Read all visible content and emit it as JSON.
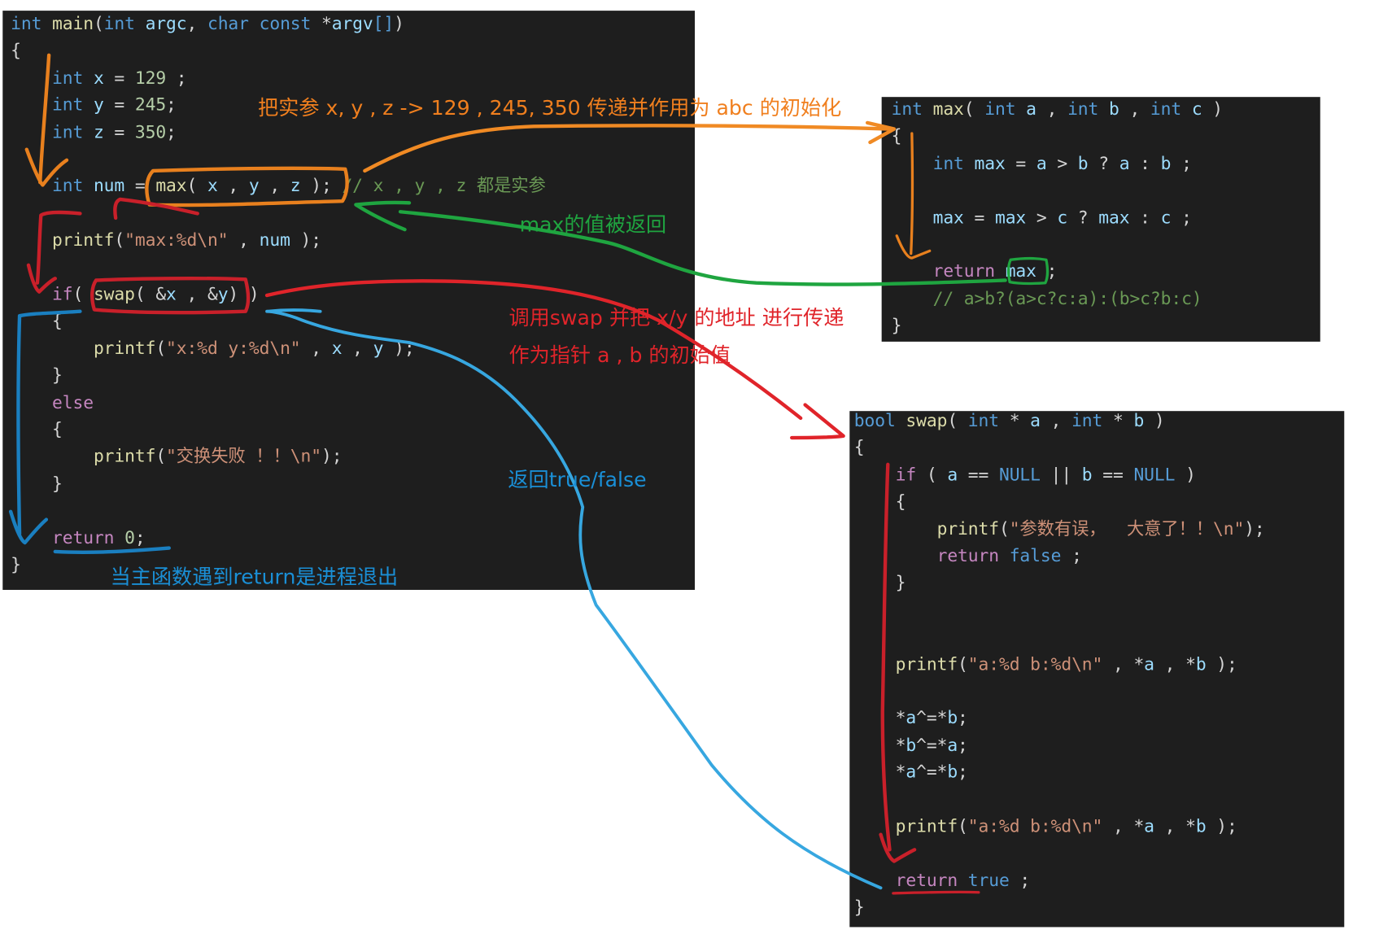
{
  "colors": {
    "orange": "#f07f1e",
    "green": "#1fa540",
    "red": "#e0242a",
    "blue": "#1a8fd6",
    "background": "#1e1e1e"
  },
  "main_code": [
    [
      [
        "int",
        "kw"
      ],
      [
        " ",
        "txt"
      ],
      [
        "main",
        "fn"
      ],
      [
        "(",
        "txt"
      ],
      [
        "int",
        "kw"
      ],
      [
        " ",
        "txt"
      ],
      [
        "argc",
        "var"
      ],
      [
        ", ",
        "txt"
      ],
      [
        "char",
        "kw"
      ],
      [
        " ",
        "txt"
      ],
      [
        "const",
        "kw"
      ],
      [
        " *",
        "txt"
      ],
      [
        "argv",
        "var"
      ],
      [
        "[]",
        "kw"
      ],
      [
        ")",
        "txt"
      ]
    ],
    [
      [
        "{",
        "txt"
      ]
    ],
    [
      [
        "    ",
        "txt"
      ],
      [
        "int",
        "kw"
      ],
      [
        " ",
        "txt"
      ],
      [
        "x",
        "var"
      ],
      [
        " = ",
        "txt"
      ],
      [
        "129",
        "num"
      ],
      [
        " ;",
        "txt"
      ]
    ],
    [
      [
        "    ",
        "txt"
      ],
      [
        "int",
        "kw"
      ],
      [
        " ",
        "txt"
      ],
      [
        "y",
        "var"
      ],
      [
        " = ",
        "txt"
      ],
      [
        "245",
        "num"
      ],
      [
        ";",
        "txt"
      ]
    ],
    [
      [
        "    ",
        "txt"
      ],
      [
        "int",
        "kw"
      ],
      [
        " ",
        "txt"
      ],
      [
        "z",
        "var"
      ],
      [
        " = ",
        "txt"
      ],
      [
        "350",
        "num"
      ],
      [
        ";",
        "txt"
      ]
    ],
    [],
    [
      [
        "    ",
        "txt"
      ],
      [
        "int",
        "kw"
      ],
      [
        " ",
        "txt"
      ],
      [
        "num",
        "var"
      ],
      [
        " = ",
        "txt"
      ],
      [
        "max",
        "fn"
      ],
      [
        "( ",
        "txt"
      ],
      [
        "x",
        "var"
      ],
      [
        " , ",
        "txt"
      ],
      [
        "y",
        "var"
      ],
      [
        " , ",
        "txt"
      ],
      [
        "z",
        "var"
      ],
      [
        " ); ",
        "txt"
      ],
      [
        "// x , y , z 都是实参",
        "cm"
      ]
    ],
    [],
    [
      [
        "    ",
        "txt"
      ],
      [
        "printf",
        "fn"
      ],
      [
        "(",
        "txt"
      ],
      [
        "\"max:%d\\n\"",
        "str"
      ],
      [
        " , ",
        "txt"
      ],
      [
        "num",
        "var"
      ],
      [
        " );",
        "txt"
      ]
    ],
    [],
    [
      [
        "    ",
        "txt"
      ],
      [
        "if",
        "ctl"
      ],
      [
        "( ",
        "txt"
      ],
      [
        "swap",
        "fn"
      ],
      [
        "( &",
        "txt"
      ],
      [
        "x",
        "var"
      ],
      [
        " , &",
        "txt"
      ],
      [
        "y",
        "var"
      ],
      [
        ") )",
        "txt"
      ]
    ],
    [
      [
        "    {",
        "txt"
      ]
    ],
    [
      [
        "        ",
        "txt"
      ],
      [
        "printf",
        "fn"
      ],
      [
        "(",
        "txt"
      ],
      [
        "\"x:%d y:%d\\n\"",
        "str"
      ],
      [
        " , ",
        "txt"
      ],
      [
        "x",
        "var"
      ],
      [
        " , ",
        "txt"
      ],
      [
        "y",
        "var"
      ],
      [
        " );",
        "txt"
      ]
    ],
    [
      [
        "    }",
        "txt"
      ]
    ],
    [
      [
        "    ",
        "txt"
      ],
      [
        "else",
        "ctl"
      ]
    ],
    [
      [
        "    {",
        "txt"
      ]
    ],
    [
      [
        "        ",
        "txt"
      ],
      [
        "printf",
        "fn"
      ],
      [
        "(",
        "txt"
      ],
      [
        "\"交换失败 ！！\\n\"",
        "str"
      ],
      [
        ");",
        "txt"
      ]
    ],
    [
      [
        "    }",
        "txt"
      ]
    ],
    [],
    [
      [
        "    ",
        "txt"
      ],
      [
        "return",
        "ctl"
      ],
      [
        " ",
        "txt"
      ],
      [
        "0",
        "num"
      ],
      [
        ";",
        "txt"
      ]
    ],
    [
      [
        "}",
        "txt"
      ]
    ]
  ],
  "max_code": [
    [
      [
        "int",
        "kw"
      ],
      [
        " ",
        "txt"
      ],
      [
        "max",
        "fn"
      ],
      [
        "( ",
        "txt"
      ],
      [
        "int",
        "kw"
      ],
      [
        " ",
        "txt"
      ],
      [
        "a",
        "var"
      ],
      [
        " , ",
        "txt"
      ],
      [
        "int",
        "kw"
      ],
      [
        " ",
        "txt"
      ],
      [
        "b",
        "var"
      ],
      [
        " , ",
        "txt"
      ],
      [
        "int",
        "kw"
      ],
      [
        " ",
        "txt"
      ],
      [
        "c",
        "var"
      ],
      [
        " )",
        "txt"
      ]
    ],
    [
      [
        "{",
        "txt"
      ]
    ],
    [
      [
        "    ",
        "txt"
      ],
      [
        "int",
        "kw"
      ],
      [
        " ",
        "txt"
      ],
      [
        "max",
        "var"
      ],
      [
        " = ",
        "txt"
      ],
      [
        "a",
        "var"
      ],
      [
        " > ",
        "txt"
      ],
      [
        "b",
        "var"
      ],
      [
        " ? ",
        "txt"
      ],
      [
        "a",
        "var"
      ],
      [
        " : ",
        "txt"
      ],
      [
        "b",
        "var"
      ],
      [
        " ;",
        "txt"
      ]
    ],
    [],
    [
      [
        "    ",
        "txt"
      ],
      [
        "max",
        "var"
      ],
      [
        " = ",
        "txt"
      ],
      [
        "max",
        "var"
      ],
      [
        " > ",
        "txt"
      ],
      [
        "c",
        "var"
      ],
      [
        " ? ",
        "txt"
      ],
      [
        "max",
        "var"
      ],
      [
        " : ",
        "txt"
      ],
      [
        "c",
        "var"
      ],
      [
        " ;",
        "txt"
      ]
    ],
    [],
    [
      [
        "    ",
        "txt"
      ],
      [
        "return",
        "ctl"
      ],
      [
        " ",
        "txt"
      ],
      [
        "max",
        "var"
      ],
      [
        " ;",
        "txt"
      ]
    ],
    [
      [
        "    ",
        "txt"
      ],
      [
        "// a>b?(a>c?c:a):(b>c?b:c)",
        "cm"
      ]
    ],
    [
      [
        "}",
        "txt"
      ]
    ]
  ],
  "swap_code": [
    [
      [
        "bool",
        "kw"
      ],
      [
        " ",
        "txt"
      ],
      [
        "swap",
        "fn"
      ],
      [
        "( ",
        "txt"
      ],
      [
        "int",
        "kw"
      ],
      [
        " * ",
        "txt"
      ],
      [
        "a",
        "var"
      ],
      [
        " , ",
        "txt"
      ],
      [
        "int",
        "kw"
      ],
      [
        " * ",
        "txt"
      ],
      [
        "b",
        "var"
      ],
      [
        " )",
        "txt"
      ]
    ],
    [
      [
        "{",
        "txt"
      ]
    ],
    [
      [
        "    ",
        "txt"
      ],
      [
        "if",
        "ctl"
      ],
      [
        " ( ",
        "txt"
      ],
      [
        "a",
        "var"
      ],
      [
        " == ",
        "txt"
      ],
      [
        "NULL",
        "const"
      ],
      [
        " || ",
        "txt"
      ],
      [
        "b",
        "var"
      ],
      [
        " == ",
        "txt"
      ],
      [
        "NULL",
        "const"
      ],
      [
        " )",
        "txt"
      ]
    ],
    [
      [
        "    {",
        "txt"
      ]
    ],
    [
      [
        "        ",
        "txt"
      ],
      [
        "printf",
        "fn"
      ],
      [
        "(",
        "txt"
      ],
      [
        "\"参数有误，  大意了！！\\n\"",
        "str"
      ],
      [
        ");",
        "txt"
      ]
    ],
    [
      [
        "        ",
        "txt"
      ],
      [
        "return",
        "ctl"
      ],
      [
        " ",
        "txt"
      ],
      [
        "false",
        "kw"
      ],
      [
        " ;",
        "txt"
      ]
    ],
    [
      [
        "    }",
        "txt"
      ]
    ],
    [],
    [],
    [
      [
        "    ",
        "txt"
      ],
      [
        "printf",
        "fn"
      ],
      [
        "(",
        "txt"
      ],
      [
        "\"a:%d b:%d\\n\"",
        "str"
      ],
      [
        " , *",
        "txt"
      ],
      [
        "a",
        "var"
      ],
      [
        " , *",
        "txt"
      ],
      [
        "b",
        "var"
      ],
      [
        " );",
        "txt"
      ]
    ],
    [],
    [
      [
        "    *",
        "txt"
      ],
      [
        "a",
        "var"
      ],
      [
        "^=*",
        "txt"
      ],
      [
        "b",
        "var"
      ],
      [
        ";",
        "txt"
      ]
    ],
    [
      [
        "    *",
        "txt"
      ],
      [
        "b",
        "var"
      ],
      [
        "^=*",
        "txt"
      ],
      [
        "a",
        "var"
      ],
      [
        ";",
        "txt"
      ]
    ],
    [
      [
        "    *",
        "txt"
      ],
      [
        "a",
        "var"
      ],
      [
        "^=*",
        "txt"
      ],
      [
        "b",
        "var"
      ],
      [
        ";",
        "txt"
      ]
    ],
    [],
    [
      [
        "    ",
        "txt"
      ],
      [
        "printf",
        "fn"
      ],
      [
        "(",
        "txt"
      ],
      [
        "\"a:%d b:%d\\n\"",
        "str"
      ],
      [
        " , *",
        "txt"
      ],
      [
        "a",
        "var"
      ],
      [
        " , *",
        "txt"
      ],
      [
        "b",
        "var"
      ],
      [
        " );",
        "txt"
      ]
    ],
    [],
    [
      [
        "    ",
        "txt"
      ],
      [
        "return",
        "ctl"
      ],
      [
        " ",
        "txt"
      ],
      [
        "true",
        "kw"
      ],
      [
        " ;",
        "txt"
      ]
    ],
    [
      [
        "}",
        "txt"
      ]
    ]
  ],
  "notes": {
    "pass_args": "把实参  x, y , z -> 129 , 245, 350 传递并作用为 abc 的初始化",
    "max_returned": "max的值被返回",
    "swap_call_1": "调用swap 并把 x/y 的地址 进行传递",
    "swap_call_2": "作为指针 a , b 的初始值",
    "return_bool": "返回true/false",
    "main_return": "当主函数遇到return是进程退出"
  }
}
